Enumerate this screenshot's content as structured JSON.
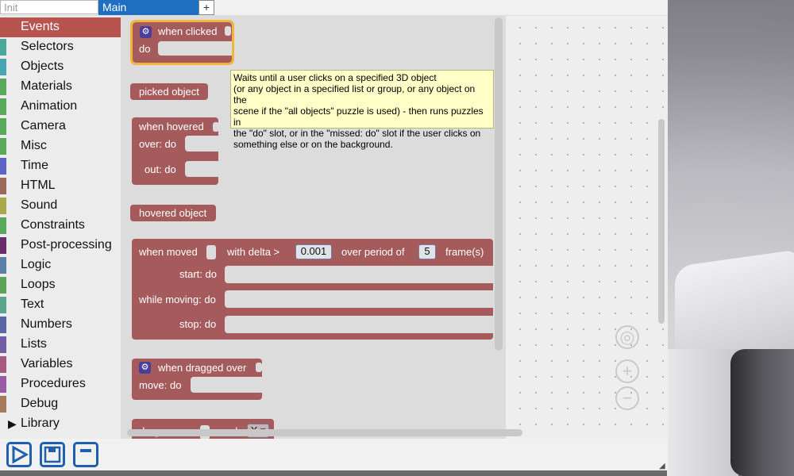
{
  "tabs": {
    "init": "Init",
    "main": "Main",
    "add": "+"
  },
  "categories": [
    {
      "label": "Events",
      "color": "#b85450",
      "selected": true
    },
    {
      "label": "Selectors",
      "color": "#4aa89a"
    },
    {
      "label": "Objects",
      "color": "#48a6b3"
    },
    {
      "label": "Materials",
      "color": "#59a95c"
    },
    {
      "label": "Animation",
      "color": "#59a95c"
    },
    {
      "label": "Camera",
      "color": "#59a95c"
    },
    {
      "label": "Misc",
      "color": "#59a95c"
    },
    {
      "label": "Time",
      "color": "#5c63c7"
    },
    {
      "label": "HTML",
      "color": "#9a6b5a"
    },
    {
      "label": "Sound",
      "color": "#a8a84a"
    },
    {
      "label": "Constraints",
      "color": "#59a95c"
    },
    {
      "label": "Post-processing",
      "color": "#6a2e6a"
    },
    {
      "label": "Logic",
      "color": "#5b80a5"
    },
    {
      "label": "Loops",
      "color": "#5ba55b"
    },
    {
      "label": "Text",
      "color": "#5ba58c"
    },
    {
      "label": "Numbers",
      "color": "#5b67a5"
    },
    {
      "label": "Lists",
      "color": "#745ba5"
    },
    {
      "label": "Variables",
      "color": "#a55b80"
    },
    {
      "label": "Procedures",
      "color": "#995ba5"
    },
    {
      "label": "Debug",
      "color": "#a57a5b"
    },
    {
      "label": "Library",
      "color": "#333333"
    }
  ],
  "blocks": {
    "when_clicked": {
      "title": "when clicked",
      "do": "do"
    },
    "picked_object": {
      "label": "picked object"
    },
    "when_hovered": {
      "title": "when hovered",
      "over": "over: do",
      "out": "out: do"
    },
    "hovered_object": {
      "label": "hovered object"
    },
    "when_moved": {
      "title": "when moved",
      "with_delta": "with delta >",
      "delta_value": "0.001",
      "over_period": "over period of",
      "period_value": "5",
      "frames": "frame(s)",
      "start": "start: do",
      "while_moving": "while moving: do",
      "stop": "stop: do"
    },
    "when_dragged_over": {
      "title": "when dragged over",
      "move": "move: do"
    },
    "drag_move": {
      "title": "drag move",
      "mode": "mode",
      "mode_value": "X ▾"
    }
  },
  "tooltip": {
    "line1": "Waits until a user clicks on a specified 3D object",
    "line2": "(or any object in a specified list or group, or any object on the",
    "line3": "scene if the \"all objects\" puzzle is used) - then runs puzzles in",
    "line4": "the \"do\" slot, or in the \"missed: do\" slot if the user clicks on",
    "line5": "something else or on the background."
  },
  "toolbar": {
    "run": "run-icon",
    "save": "save-icon",
    "minimize": "minimize-icon"
  },
  "colors": {
    "accent": "#1e6fc2",
    "event_block": "#a55b5b",
    "selection": "#f2b53a",
    "gear": "#4b3d9e"
  }
}
